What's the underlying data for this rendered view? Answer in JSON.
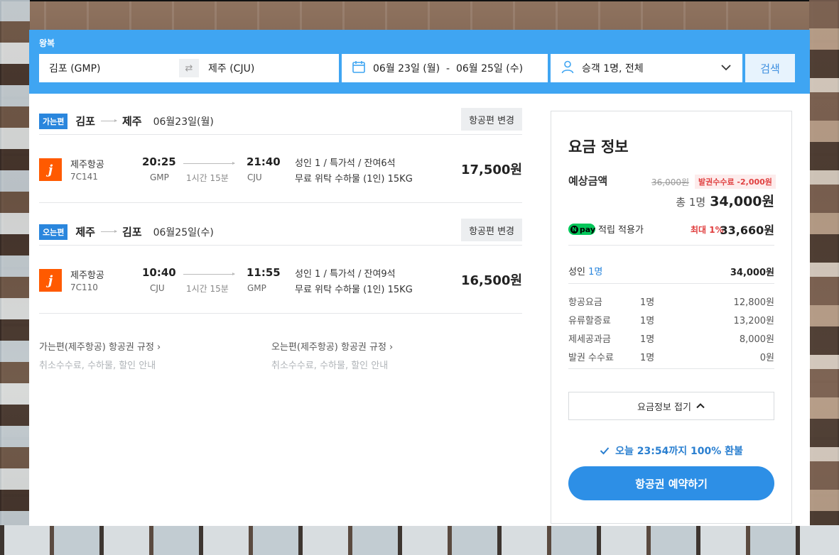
{
  "search": {
    "trip_type": "왕복",
    "origin": "김포 (GMP)",
    "destination": "제주 (CJU)",
    "swap_icon": "⇄",
    "date_range": "06월 23일 (월)  -  06월 25일 (수)",
    "passengers": "승객 1명, 전체",
    "search_label": "검색"
  },
  "outbound": {
    "badge": "가는편",
    "from": "김포",
    "to": "제주",
    "date": "06월23일(월)",
    "change_label": "항공편 변경",
    "airline": "제주항공",
    "airline_logo": "j",
    "flight_no": "7C141",
    "dep_time": "20:25",
    "dep_code": "GMP",
    "duration": "1시간 15분",
    "arr_time": "21:40",
    "arr_code": "CJU",
    "seat_info": "성인 1 / 특가석 / 잔여6석",
    "baggage": "무료 위탁 수하물 (1인) 15KG",
    "price": "17,500원"
  },
  "inbound": {
    "badge": "오는편",
    "from": "제주",
    "to": "김포",
    "date": "06월25일(수)",
    "change_label": "항공편 변경",
    "airline": "제주항공",
    "airline_logo": "j",
    "flight_no": "7C110",
    "dep_time": "10:40",
    "dep_code": "CJU",
    "duration": "1시간 15분",
    "arr_time": "11:55",
    "arr_code": "GMP",
    "seat_info": "성인 1 / 특가석 / 잔여9석",
    "baggage": "무료 위탁 수하물 (1인) 15KG",
    "price": "16,500원"
  },
  "rules": {
    "outbound_link": "가는편(제주항공) 항공권 규정 ›",
    "outbound_sub": "취소수수료, 수하물, 할인 안내",
    "inbound_link": "오는편(제주항공) 항공권 규정 ›",
    "inbound_sub": "취소수수료, 수하물, 할인 안내"
  },
  "fare": {
    "title": "요금 정보",
    "estimate_label": "예상금액",
    "original_price": "36,000원",
    "discount_tag": "발권수수료 -2,000원",
    "total_prefix": "총 1명",
    "total_amount": "34,000원",
    "npay_logo": "pay",
    "npay_n": "N",
    "npay_label": "적립 적용가",
    "npay_max": "최대 1%",
    "npay_amount": "33,660원",
    "adult_label": "성인",
    "adult_count": "1명",
    "adult_amount": "34,000원",
    "rows": [
      {
        "name": "항공요금",
        "qty": "1명",
        "amount": "12,800원"
      },
      {
        "name": "유류할증료",
        "qty": "1명",
        "amount": "13,200원"
      },
      {
        "name": "제세공과금",
        "qty": "1명",
        "amount": "8,000원"
      },
      {
        "name": "발권 수수료",
        "qty": "1명",
        "amount": "0원"
      }
    ],
    "collapse_label": "요금정보 접기",
    "refund_note": "오늘 23:54까지 100% 환불",
    "book_label": "항공권 예약하기"
  },
  "colors": {
    "accent": "#3fa5f2",
    "badge": "#2a86dd",
    "airline": "#ff5a00",
    "discount": "#e04040",
    "npay": "#03c75a"
  }
}
